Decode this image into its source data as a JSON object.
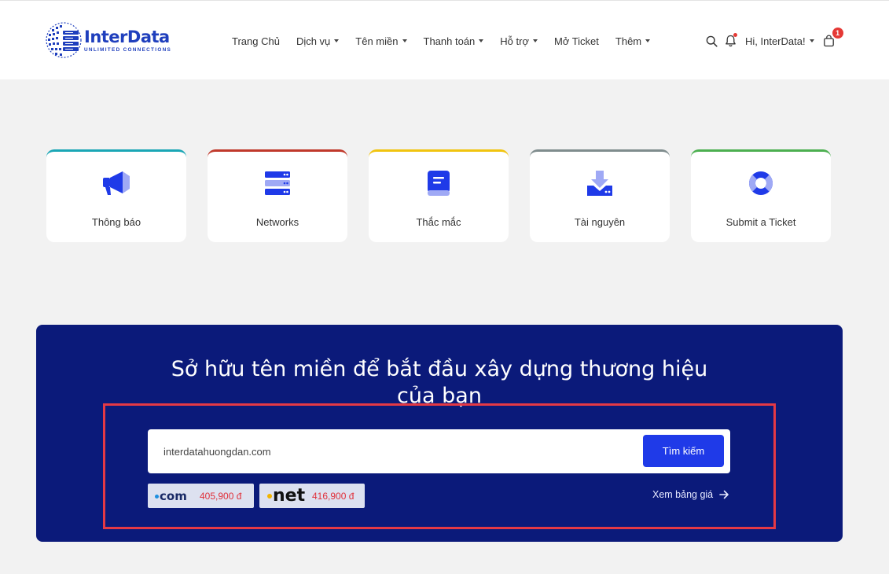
{
  "brand": {
    "name": "InterData",
    "tagline": "UNLIMITED CONNECTIONS",
    "color": "#1f3fbd"
  },
  "nav": {
    "items": [
      {
        "label": "Trang Chủ",
        "dropdown": false
      },
      {
        "label": "Dịch vụ",
        "dropdown": true
      },
      {
        "label": "Tên miền",
        "dropdown": true
      },
      {
        "label": "Thanh toán",
        "dropdown": true
      },
      {
        "label": "Hỗ trợ",
        "dropdown": true
      },
      {
        "label": "Mở Ticket",
        "dropdown": false
      },
      {
        "label": "Thêm",
        "dropdown": true
      }
    ]
  },
  "user": {
    "greeting": "Hi, InterData!",
    "cart_count": "1"
  },
  "cards": [
    {
      "label": "Thông báo",
      "icon": "megaphone-icon",
      "accent": "#1aa6b5"
    },
    {
      "label": "Networks",
      "icon": "server-icon",
      "accent": "#c0392b"
    },
    {
      "label": "Thắc mắc",
      "icon": "book-icon",
      "accent": "#f1c40f"
    },
    {
      "label": "Tài nguyên",
      "icon": "download-icon",
      "accent": "#7f8c8d"
    },
    {
      "label": "Submit a Ticket",
      "icon": "lifebuoy-icon",
      "accent": "#4caf50"
    }
  ],
  "domain": {
    "title": "Sở hữu tên miền để bắt đầu xây dựng thương hiệu của bạn",
    "search_value": "interdatahuongdan.com",
    "search_button": "Tìm kiếm",
    "tlds": [
      {
        "name": "com",
        "price": "405,900 đ"
      },
      {
        "name": "net",
        "price": "416,900 đ"
      }
    ],
    "price_link": "Xem bảng giá",
    "background": "#0b1a7a"
  }
}
